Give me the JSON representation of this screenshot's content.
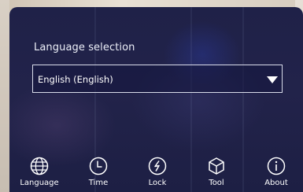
{
  "panel": {
    "title": "Language selection"
  },
  "language_select": {
    "selected": "English (English)"
  },
  "toolbar": {
    "items": [
      {
        "label": "Language",
        "icon": "globe-icon"
      },
      {
        "label": "Time",
        "icon": "clock-icon"
      },
      {
        "label": "Lock",
        "icon": "lock-icon"
      },
      {
        "label": "Tool",
        "icon": "cube-icon"
      },
      {
        "label": "About",
        "icon": "info-icon"
      }
    ]
  }
}
